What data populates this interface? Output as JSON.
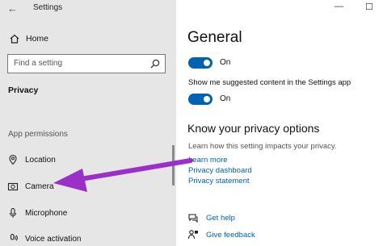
{
  "window": {
    "title": "Settings",
    "controls": {
      "minimize": "—",
      "maximize": "☐"
    }
  },
  "sidebar": {
    "home_label": "Home",
    "search_placeholder": "Find a setting",
    "section_privacy": "Privacy",
    "section_app_permissions": "App permissions",
    "items": [
      {
        "label": "Location",
        "icon": "location-icon"
      },
      {
        "label": "Camera",
        "icon": "camera-icon"
      },
      {
        "label": "Microphone",
        "icon": "microphone-icon"
      },
      {
        "label": "Voice activation",
        "icon": "voice-activation-icon"
      }
    ]
  },
  "main": {
    "title": "General",
    "toggle1": {
      "state": "On",
      "color": "#0063b1"
    },
    "setting2_text": "Show me suggested content in the Settings app",
    "toggle2": {
      "state": "On",
      "color": "#0063b1"
    },
    "privacy_heading": "Know your privacy options",
    "privacy_desc": "Learn how this setting impacts your privacy.",
    "links": [
      "Learn more",
      "Privacy dashboard",
      "Privacy statement"
    ],
    "help": {
      "get_help": "Get help",
      "give_feedback": "Give feedback"
    }
  },
  "annotation": {
    "arrow_color": "#9b30c8"
  }
}
